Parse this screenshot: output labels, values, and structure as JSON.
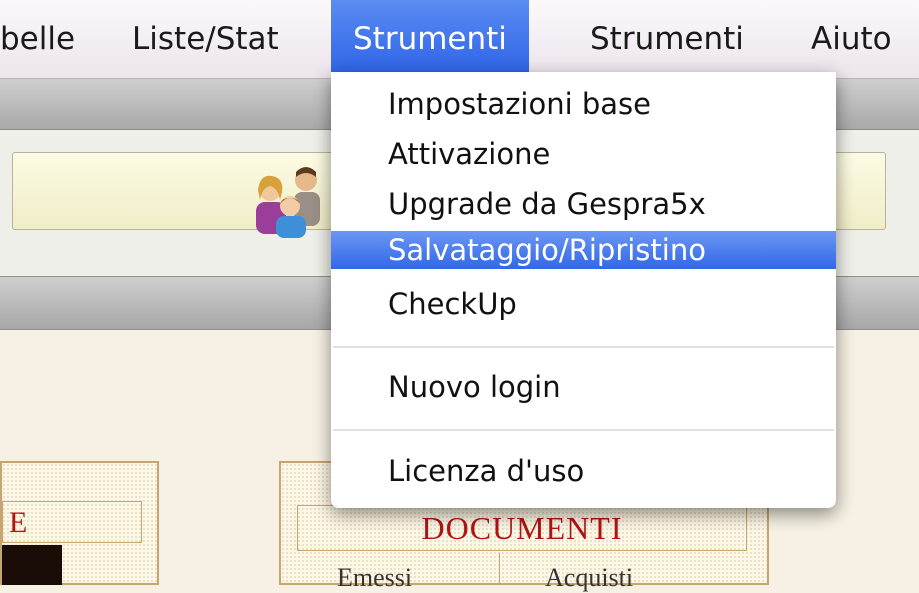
{
  "menubar": {
    "items": [
      {
        "label": "belle"
      },
      {
        "label": "Liste/Stat"
      },
      {
        "label": "Strumenti"
      },
      {
        "label": "Strumenti"
      },
      {
        "label": "Aiuto"
      }
    ]
  },
  "dropdown": {
    "items": [
      {
        "label": "Impostazioni base"
      },
      {
        "label": "Attivazione"
      },
      {
        "label": "Upgrade da Gespra5x"
      },
      {
        "label": "Salvataggio/Ripristino"
      },
      {
        "label": "CheckUp"
      },
      {
        "label": "Nuovo login"
      },
      {
        "label": "Licenza d'uso"
      }
    ],
    "selected_index": 3
  },
  "panels": {
    "left_letter": "E",
    "documents_title": "DOCUMENTI",
    "documents_sub1": "Emessi",
    "documents_sub2": "Acquisti"
  },
  "icons": {
    "people": "people-icon"
  },
  "colors": {
    "menu_highlight": "#3a6eea",
    "panel_title_red": "#b01515",
    "panel_border": "#c7a56e"
  }
}
